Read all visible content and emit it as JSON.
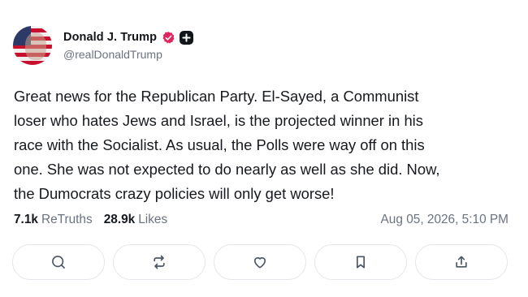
{
  "author": {
    "display_name": "Donald J. Trump",
    "handle": "@realDonaldTrump",
    "avatar_icon": "avatar-flag-portrait",
    "badges": [
      "verified-badge-icon",
      "plus-badge-icon"
    ]
  },
  "post": {
    "text": "Great news for the Republican Party. El-Sayed, a Communist\nloser who hates Jews and Israel, is the projected winner in his\nrace with the Socialist. As usual, the Polls were way off on this\none. She was not expected to do nearly as well as she did. Now,\nthe Dumocrats crazy policies will only get worse!"
  },
  "stats": {
    "retruths_count": "7.1k",
    "retruths_label": "ReTruths",
    "likes_count": "28.9k",
    "likes_label": "Likes",
    "timestamp": "Aug 05, 2026, 5:10 PM"
  },
  "actions": [
    {
      "icon": "reply-icon"
    },
    {
      "icon": "retruth-icon"
    },
    {
      "icon": "like-icon"
    },
    {
      "icon": "bookmark-icon"
    },
    {
      "icon": "share-icon"
    }
  ],
  "colors": {
    "text": "#16191d",
    "muted": "#6b7280",
    "verified_badge": "#e0245e",
    "border": "#e3e6ea"
  }
}
